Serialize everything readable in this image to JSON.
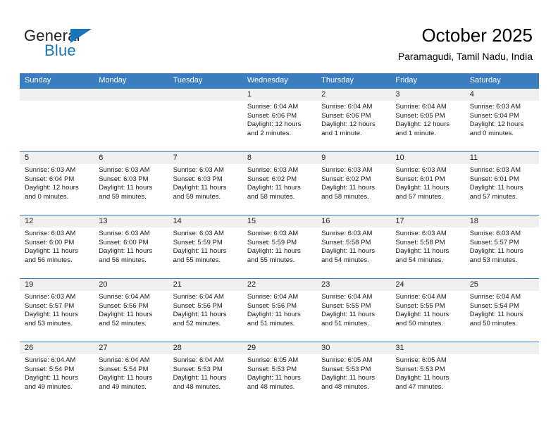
{
  "brand": {
    "name_part1": "General",
    "name_part2": "Blue",
    "triangle_color": "#1b75bb",
    "text_color": "#231f20"
  },
  "header": {
    "title": "October 2025",
    "subtitle": "Paramagudi, Tamil Nadu, India"
  },
  "theme": {
    "header_blue": "#3b7ec0",
    "daynum_strip": "#f0f0f0",
    "text": "#1a1a1a"
  },
  "weekdays": [
    "Sunday",
    "Monday",
    "Tuesday",
    "Wednesday",
    "Thursday",
    "Friday",
    "Saturday"
  ],
  "labels": {
    "sunrise_prefix": "Sunrise:",
    "sunset_prefix": "Sunset:",
    "daylight_prefix": "Daylight:"
  },
  "weeks": [
    [
      {
        "day": "",
        "sunrise": "",
        "sunset": "",
        "daylight_line1": "",
        "daylight_line2": "",
        "empty": true
      },
      {
        "day": "",
        "sunrise": "",
        "sunset": "",
        "daylight_line1": "",
        "daylight_line2": "",
        "empty": true
      },
      {
        "day": "",
        "sunrise": "",
        "sunset": "",
        "daylight_line1": "",
        "daylight_line2": "",
        "empty": true
      },
      {
        "day": "1",
        "sunrise": "Sunrise: 6:04 AM",
        "sunset": "Sunset: 6:06 PM",
        "daylight_line1": "Daylight: 12 hours",
        "daylight_line2": "and 2 minutes.",
        "empty": false
      },
      {
        "day": "2",
        "sunrise": "Sunrise: 6:04 AM",
        "sunset": "Sunset: 6:06 PM",
        "daylight_line1": "Daylight: 12 hours",
        "daylight_line2": "and 1 minute.",
        "empty": false
      },
      {
        "day": "3",
        "sunrise": "Sunrise: 6:04 AM",
        "sunset": "Sunset: 6:05 PM",
        "daylight_line1": "Daylight: 12 hours",
        "daylight_line2": "and 1 minute.",
        "empty": false
      },
      {
        "day": "4",
        "sunrise": "Sunrise: 6:03 AM",
        "sunset": "Sunset: 6:04 PM",
        "daylight_line1": "Daylight: 12 hours",
        "daylight_line2": "and 0 minutes.",
        "empty": false
      }
    ],
    [
      {
        "day": "5",
        "sunrise": "Sunrise: 6:03 AM",
        "sunset": "Sunset: 6:04 PM",
        "daylight_line1": "Daylight: 12 hours",
        "daylight_line2": "and 0 minutes.",
        "empty": false
      },
      {
        "day": "6",
        "sunrise": "Sunrise: 6:03 AM",
        "sunset": "Sunset: 6:03 PM",
        "daylight_line1": "Daylight: 11 hours",
        "daylight_line2": "and 59 minutes.",
        "empty": false
      },
      {
        "day": "7",
        "sunrise": "Sunrise: 6:03 AM",
        "sunset": "Sunset: 6:03 PM",
        "daylight_line1": "Daylight: 11 hours",
        "daylight_line2": "and 59 minutes.",
        "empty": false
      },
      {
        "day": "8",
        "sunrise": "Sunrise: 6:03 AM",
        "sunset": "Sunset: 6:02 PM",
        "daylight_line1": "Daylight: 11 hours",
        "daylight_line2": "and 58 minutes.",
        "empty": false
      },
      {
        "day": "9",
        "sunrise": "Sunrise: 6:03 AM",
        "sunset": "Sunset: 6:02 PM",
        "daylight_line1": "Daylight: 11 hours",
        "daylight_line2": "and 58 minutes.",
        "empty": false
      },
      {
        "day": "10",
        "sunrise": "Sunrise: 6:03 AM",
        "sunset": "Sunset: 6:01 PM",
        "daylight_line1": "Daylight: 11 hours",
        "daylight_line2": "and 57 minutes.",
        "empty": false
      },
      {
        "day": "11",
        "sunrise": "Sunrise: 6:03 AM",
        "sunset": "Sunset: 6:01 PM",
        "daylight_line1": "Daylight: 11 hours",
        "daylight_line2": "and 57 minutes.",
        "empty": false
      }
    ],
    [
      {
        "day": "12",
        "sunrise": "Sunrise: 6:03 AM",
        "sunset": "Sunset: 6:00 PM",
        "daylight_line1": "Daylight: 11 hours",
        "daylight_line2": "and 56 minutes.",
        "empty": false
      },
      {
        "day": "13",
        "sunrise": "Sunrise: 6:03 AM",
        "sunset": "Sunset: 6:00 PM",
        "daylight_line1": "Daylight: 11 hours",
        "daylight_line2": "and 56 minutes.",
        "empty": false
      },
      {
        "day": "14",
        "sunrise": "Sunrise: 6:03 AM",
        "sunset": "Sunset: 5:59 PM",
        "daylight_line1": "Daylight: 11 hours",
        "daylight_line2": "and 55 minutes.",
        "empty": false
      },
      {
        "day": "15",
        "sunrise": "Sunrise: 6:03 AM",
        "sunset": "Sunset: 5:59 PM",
        "daylight_line1": "Daylight: 11 hours",
        "daylight_line2": "and 55 minutes.",
        "empty": false
      },
      {
        "day": "16",
        "sunrise": "Sunrise: 6:03 AM",
        "sunset": "Sunset: 5:58 PM",
        "daylight_line1": "Daylight: 11 hours",
        "daylight_line2": "and 54 minutes.",
        "empty": false
      },
      {
        "day": "17",
        "sunrise": "Sunrise: 6:03 AM",
        "sunset": "Sunset: 5:58 PM",
        "daylight_line1": "Daylight: 11 hours",
        "daylight_line2": "and 54 minutes.",
        "empty": false
      },
      {
        "day": "18",
        "sunrise": "Sunrise: 6:03 AM",
        "sunset": "Sunset: 5:57 PM",
        "daylight_line1": "Daylight: 11 hours",
        "daylight_line2": "and 53 minutes.",
        "empty": false
      }
    ],
    [
      {
        "day": "19",
        "sunrise": "Sunrise: 6:03 AM",
        "sunset": "Sunset: 5:57 PM",
        "daylight_line1": "Daylight: 11 hours",
        "daylight_line2": "and 53 minutes.",
        "empty": false
      },
      {
        "day": "20",
        "sunrise": "Sunrise: 6:04 AM",
        "sunset": "Sunset: 5:56 PM",
        "daylight_line1": "Daylight: 11 hours",
        "daylight_line2": "and 52 minutes.",
        "empty": false
      },
      {
        "day": "21",
        "sunrise": "Sunrise: 6:04 AM",
        "sunset": "Sunset: 5:56 PM",
        "daylight_line1": "Daylight: 11 hours",
        "daylight_line2": "and 52 minutes.",
        "empty": false
      },
      {
        "day": "22",
        "sunrise": "Sunrise: 6:04 AM",
        "sunset": "Sunset: 5:56 PM",
        "daylight_line1": "Daylight: 11 hours",
        "daylight_line2": "and 51 minutes.",
        "empty": false
      },
      {
        "day": "23",
        "sunrise": "Sunrise: 6:04 AM",
        "sunset": "Sunset: 5:55 PM",
        "daylight_line1": "Daylight: 11 hours",
        "daylight_line2": "and 51 minutes.",
        "empty": false
      },
      {
        "day": "24",
        "sunrise": "Sunrise: 6:04 AM",
        "sunset": "Sunset: 5:55 PM",
        "daylight_line1": "Daylight: 11 hours",
        "daylight_line2": "and 50 minutes.",
        "empty": false
      },
      {
        "day": "25",
        "sunrise": "Sunrise: 6:04 AM",
        "sunset": "Sunset: 5:54 PM",
        "daylight_line1": "Daylight: 11 hours",
        "daylight_line2": "and 50 minutes.",
        "empty": false
      }
    ],
    [
      {
        "day": "26",
        "sunrise": "Sunrise: 6:04 AM",
        "sunset": "Sunset: 5:54 PM",
        "daylight_line1": "Daylight: 11 hours",
        "daylight_line2": "and 49 minutes.",
        "empty": false
      },
      {
        "day": "27",
        "sunrise": "Sunrise: 6:04 AM",
        "sunset": "Sunset: 5:54 PM",
        "daylight_line1": "Daylight: 11 hours",
        "daylight_line2": "and 49 minutes.",
        "empty": false
      },
      {
        "day": "28",
        "sunrise": "Sunrise: 6:04 AM",
        "sunset": "Sunset: 5:53 PM",
        "daylight_line1": "Daylight: 11 hours",
        "daylight_line2": "and 48 minutes.",
        "empty": false
      },
      {
        "day": "29",
        "sunrise": "Sunrise: 6:05 AM",
        "sunset": "Sunset: 5:53 PM",
        "daylight_line1": "Daylight: 11 hours",
        "daylight_line2": "and 48 minutes.",
        "empty": false
      },
      {
        "day": "30",
        "sunrise": "Sunrise: 6:05 AM",
        "sunset": "Sunset: 5:53 PM",
        "daylight_line1": "Daylight: 11 hours",
        "daylight_line2": "and 48 minutes.",
        "empty": false
      },
      {
        "day": "31",
        "sunrise": "Sunrise: 6:05 AM",
        "sunset": "Sunset: 5:53 PM",
        "daylight_line1": "Daylight: 11 hours",
        "daylight_line2": "and 47 minutes.",
        "empty": false
      },
      {
        "day": "",
        "sunrise": "",
        "sunset": "",
        "daylight_line1": "",
        "daylight_line2": "",
        "empty": true
      }
    ]
  ]
}
